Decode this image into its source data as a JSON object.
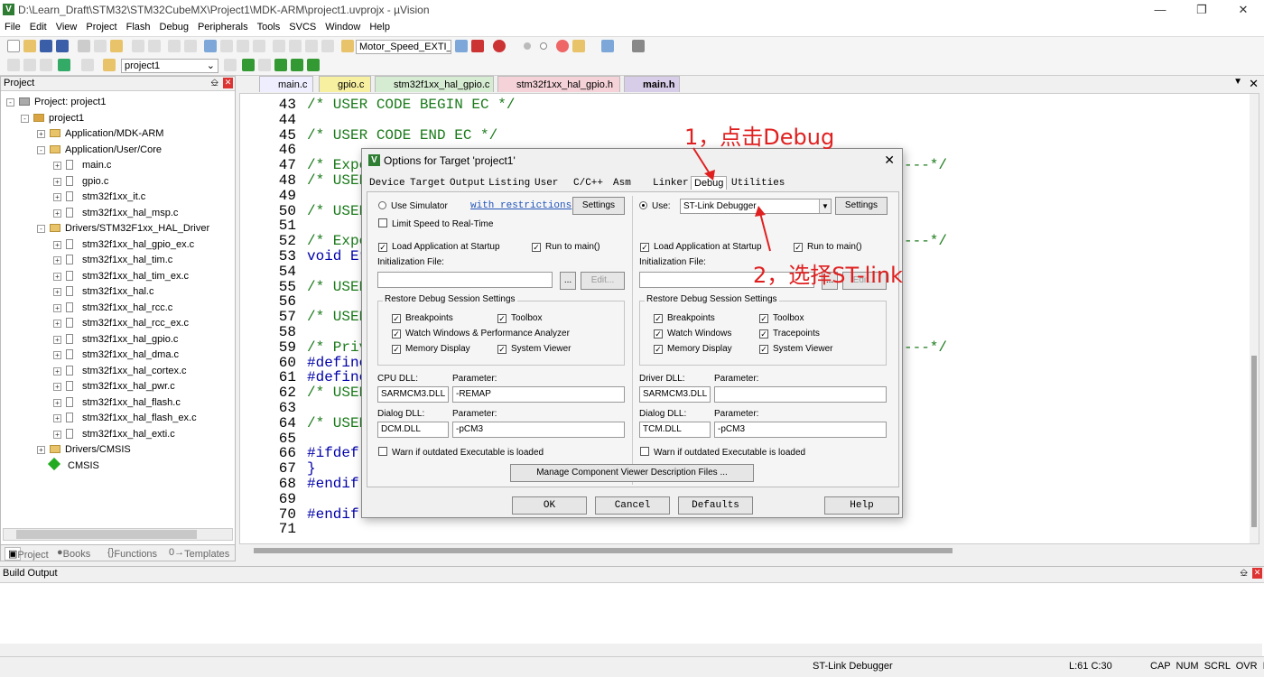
{
  "window": {
    "title": "D:\\Learn_Draft\\STM32\\STM32CubeMX\\Project1\\MDK-ARM\\project1.uvprojx - µVision"
  },
  "menu": [
    "File",
    "Edit",
    "View",
    "Project",
    "Flash",
    "Debug",
    "Peripherals",
    "Tools",
    "SVCS",
    "Window",
    "Help"
  ],
  "toolbar": {
    "target_combo": "Motor_Speed_EXTI_I",
    "project_combo": "project1"
  },
  "project_pane": {
    "title": "Project",
    "tree": [
      "Project: project1",
      "project1",
      "Application/MDK-ARM",
      "Application/User/Core",
      "main.c",
      "gpio.c",
      "stm32f1xx_it.c",
      "stm32f1xx_hal_msp.c",
      "Drivers/STM32F1xx_HAL_Driver",
      "stm32f1xx_hal_gpio_ex.c",
      "stm32f1xx_hal_tim.c",
      "stm32f1xx_hal_tim_ex.c",
      "stm32f1xx_hal.c",
      "stm32f1xx_hal_rcc.c",
      "stm32f1xx_hal_rcc_ex.c",
      "stm32f1xx_hal_gpio.c",
      "stm32f1xx_hal_dma.c",
      "stm32f1xx_hal_cortex.c",
      "stm32f1xx_hal_pwr.c",
      "stm32f1xx_hal_flash.c",
      "stm32f1xx_hal_flash_ex.c",
      "stm32f1xx_hal_exti.c",
      "Drivers/CMSIS",
      "CMSIS"
    ],
    "tabs": [
      "Project",
      "Books",
      "Functions",
      "Templates"
    ]
  },
  "editor": {
    "tabs": [
      "main.c",
      "gpio.c",
      "stm32f1xx_hal_gpio.c",
      "stm32f1xx_hal_gpio.h",
      "main.h"
    ],
    "line_numbers": [
      "43",
      "44",
      "45",
      "46",
      "47",
      "48",
      "49",
      "50",
      "51",
      "52",
      "53",
      "54",
      "55",
      "56",
      "57",
      "58",
      "59",
      "60",
      "61",
      "62",
      "63",
      "64",
      "65",
      "66",
      "67",
      "68",
      "69",
      "70",
      "71"
    ],
    "lines": [
      "/* USER CODE BEGIN EC */",
      "",
      "/* USER CODE END EC */",
      "",
      "/* Expo",
      "/* USER",
      "",
      "/* USER",
      "",
      "/* Expo",
      "void Er",
      "",
      "/* USER",
      "",
      "/* USER",
      "",
      "/* Priv",
      "#define",
      "#define",
      "/* USER",
      "",
      "/* USER",
      "",
      "#ifdef",
      "}",
      "#endif",
      "",
      "#endif",
      ""
    ],
    "right_frag_47": "---*/",
    "right_frag_52": "---*/",
    "right_frag_59": "---*/"
  },
  "dialog": {
    "title": "Options for Target 'project1'",
    "tabs": [
      "Device",
      "Target",
      "Output",
      "Listing",
      "User",
      "C/C++",
      "Asm",
      "Linker",
      "Debug",
      "Utilities"
    ],
    "left": {
      "use_simulator": "Use Simulator",
      "with_restrictions": "with restrictions",
      "settings": "Settings",
      "limit_speed": "Limit Speed to Real-Time",
      "load_app": "Load Application at Startup",
      "run_main": "Run to main()",
      "init_file": "Initialization File:",
      "browse": "...",
      "edit": "Edit...",
      "restore_title": "Restore Debug Session Settings",
      "breakpoints": "Breakpoints",
      "toolbox": "Toolbox",
      "watch": "Watch Windows & Performance Analyzer",
      "memory": "Memory Display",
      "sysviewer": "System Viewer",
      "cpu_dll": "CPU DLL:",
      "cpu_dll_val": "SARMCM3.DLL",
      "param": "Parameter:",
      "cpu_param_val": "-REMAP",
      "dialog_dll": "Dialog DLL:",
      "dialog_dll_val": "DCM.DLL",
      "dialog_param_val": "-pCM3",
      "warn": "Warn if outdated Executable is loaded"
    },
    "right": {
      "use": "Use:",
      "debugger": "ST-Link Debugger",
      "settings": "Settings",
      "load_app": "Load Application at Startup",
      "run_main": "Run to main()",
      "init_file": "Initialization File:",
      "browse": "...",
      "edit": "Edit...",
      "restore_title": "Restore Debug Session Settings",
      "breakpoints": "Breakpoints",
      "toolbox": "Toolbox",
      "watch": "Watch Windows",
      "tracepoints": "Tracepoints",
      "memory": "Memory Display",
      "sysviewer": "System Viewer",
      "driver_dll": "Driver DLL:",
      "driver_dll_val": "SARMCM3.DLL",
      "param": "Parameter:",
      "driver_param_val": "",
      "dialog_dll": "Dialog DLL:",
      "dialog_dll_val": "TCM.DLL",
      "dialog_param_val": "-pCM3",
      "warn": "Warn if outdated Executable is loaded"
    },
    "manage": "Manage Component Viewer Description Files ...",
    "ok": "OK",
    "cancel": "Cancel",
    "defaults": "Defaults",
    "help": "Help"
  },
  "annotations": {
    "a1": "1，点击Debug",
    "a2": "2，选择ST-link"
  },
  "build": {
    "title": "Build Output"
  },
  "status": {
    "debugger": "ST-Link Debugger",
    "pos": "L:61 C:30",
    "flags": "CAP  NUM  SCRL  OVR  R/W"
  }
}
